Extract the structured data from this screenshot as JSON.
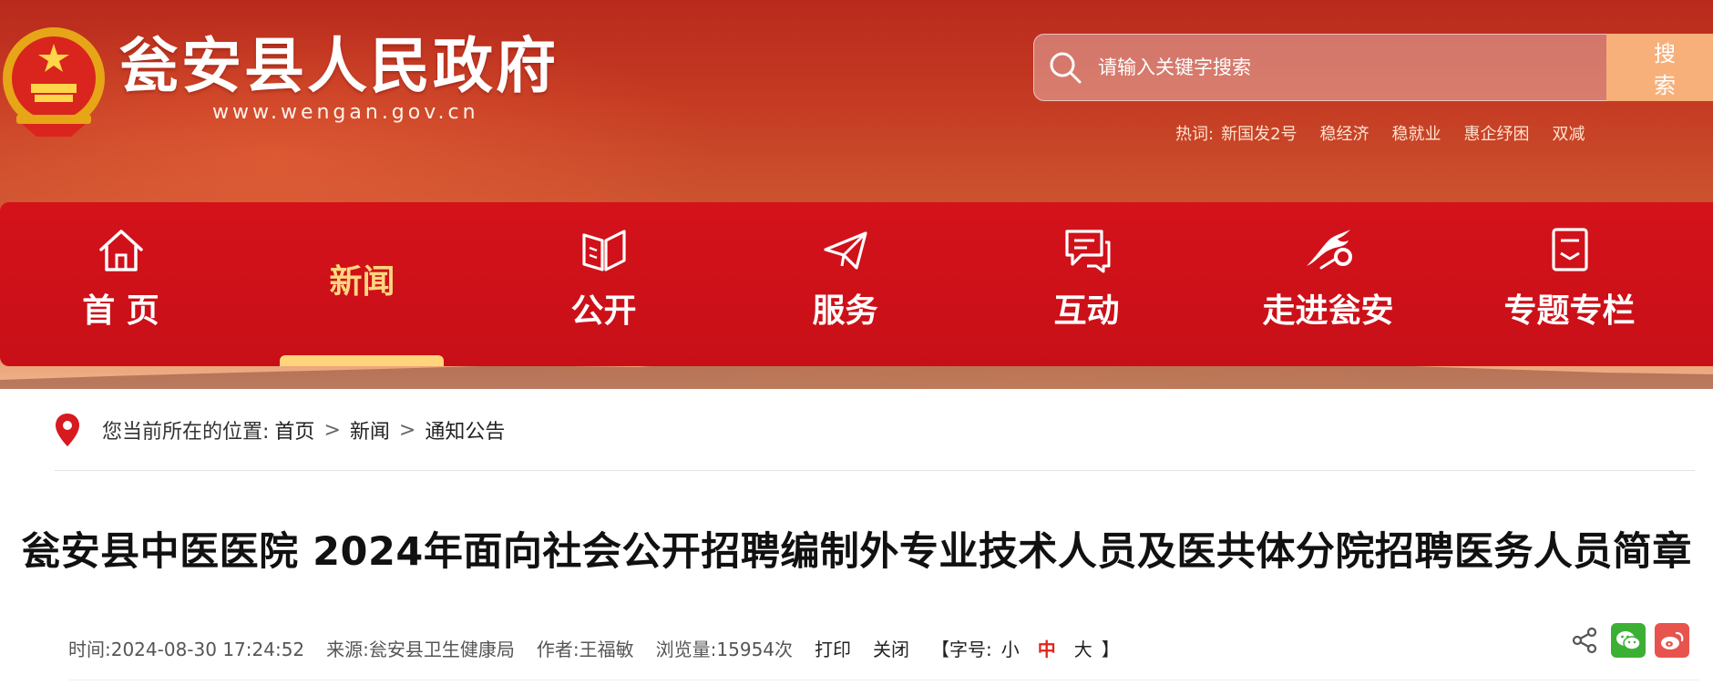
{
  "header": {
    "site_title": "瓮安县人民政府",
    "site_url": "www.wengan.gov.cn",
    "emblem_icon": "national-emblem-icon",
    "colors": {
      "banner": "#c43a22",
      "nav": "#d4121a",
      "accent": "#ffd680"
    }
  },
  "search": {
    "placeholder": "请输入关键字搜索",
    "value": "",
    "button_label": "搜索",
    "icon": "search-icon"
  },
  "hotwords": {
    "label": "热词:",
    "items": [
      "新国发2号",
      "稳经济",
      "稳就业",
      "惠企纾困",
      "双减"
    ]
  },
  "nav": {
    "items": [
      {
        "label": "首 页",
        "icon": "home-icon",
        "active": false
      },
      {
        "label": "新闻",
        "icon": "",
        "active": true
      },
      {
        "label": "公开",
        "icon": "book-icon",
        "active": false
      },
      {
        "label": "服务",
        "icon": "paper-plane-icon",
        "active": false
      },
      {
        "label": "互动",
        "icon": "chat-icon",
        "active": false
      },
      {
        "label": "走进瓮安",
        "icon": "dragon-icon",
        "active": false
      },
      {
        "label": "专题专栏",
        "icon": "document-icon",
        "active": false
      }
    ]
  },
  "breadcrumb": {
    "prefix": "您当前所在的位置:",
    "items": [
      "首页",
      "新闻",
      "通知公告"
    ],
    "separator": ">"
  },
  "article": {
    "title": "瓮安县中医医院 2024年面向社会公开招聘编制外专业技术人员及医共体分院招聘医务人员简章",
    "meta": {
      "time": "时间:2024-08-30 17:24:52",
      "source": "来源:瓮安县卫生健康局",
      "author": "作者:王福敏",
      "views": "浏览量:15954次",
      "print_label": "打印",
      "close_label": "关闭",
      "font_size_prefix": "【字号:",
      "font_sizes": [
        "小",
        "中",
        "大"
      ],
      "font_size_suffix": "】",
      "selected_font_size": "中"
    },
    "share_icons": [
      "share-icon",
      "wechat-icon",
      "weibo-icon"
    ]
  }
}
